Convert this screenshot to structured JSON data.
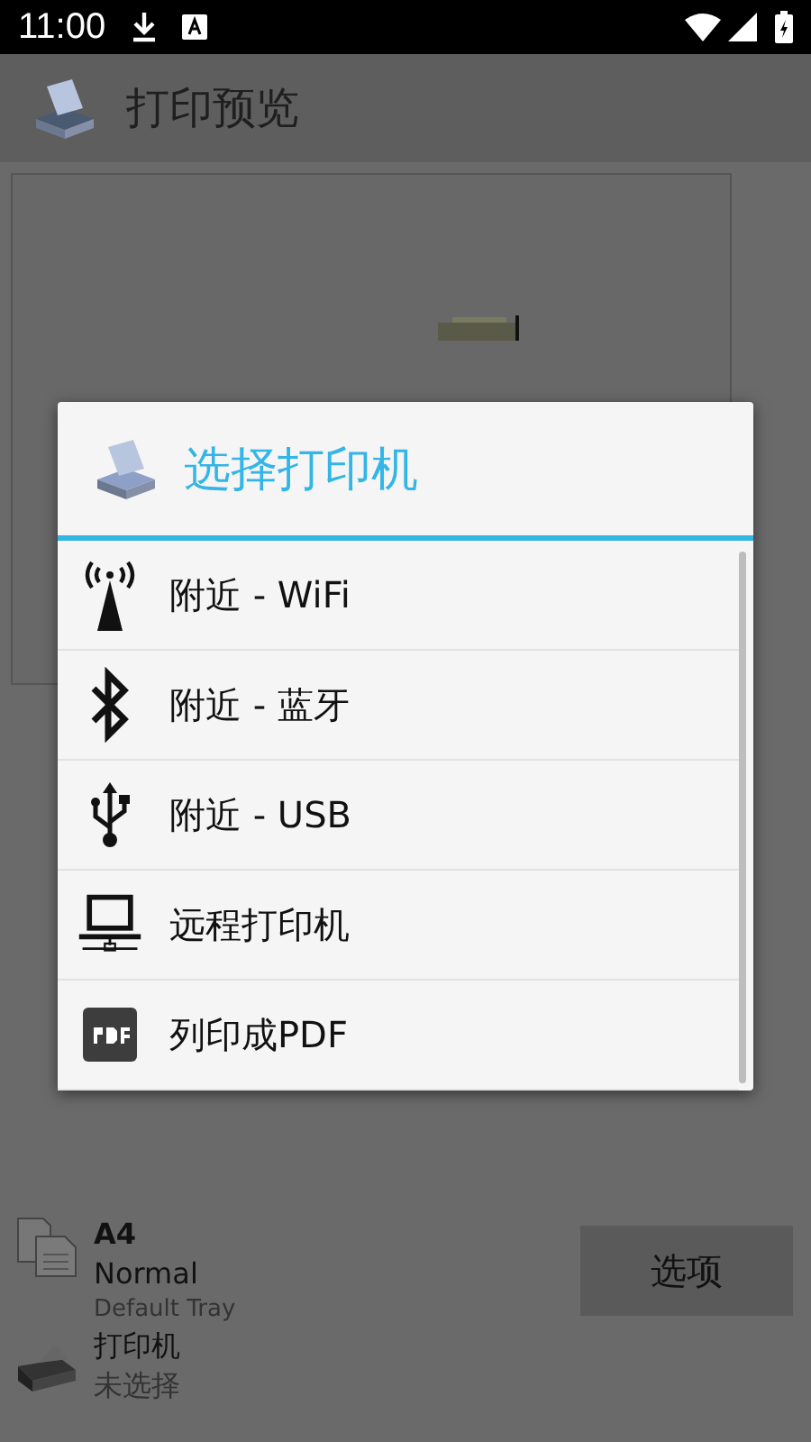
{
  "status_bar": {
    "time": "11:00"
  },
  "app_bar": {
    "title": "打印预览"
  },
  "dialog": {
    "title": "选择打印机",
    "options": [
      {
        "kind": "wifi",
        "label": "附近 - WiFi"
      },
      {
        "kind": "bluetooth",
        "label": "附近 - 蓝牙"
      },
      {
        "kind": "usb",
        "label": "附近 - USB"
      },
      {
        "kind": "remote",
        "label": "远程打印机"
      },
      {
        "kind": "pdf",
        "label": "列印成PDF"
      }
    ]
  },
  "page_settings": {
    "paper": "A4",
    "quality": "Normal",
    "tray": "Default Tray"
  },
  "printer": {
    "label": "打印机",
    "value": "未选择"
  },
  "options_button": "选项"
}
